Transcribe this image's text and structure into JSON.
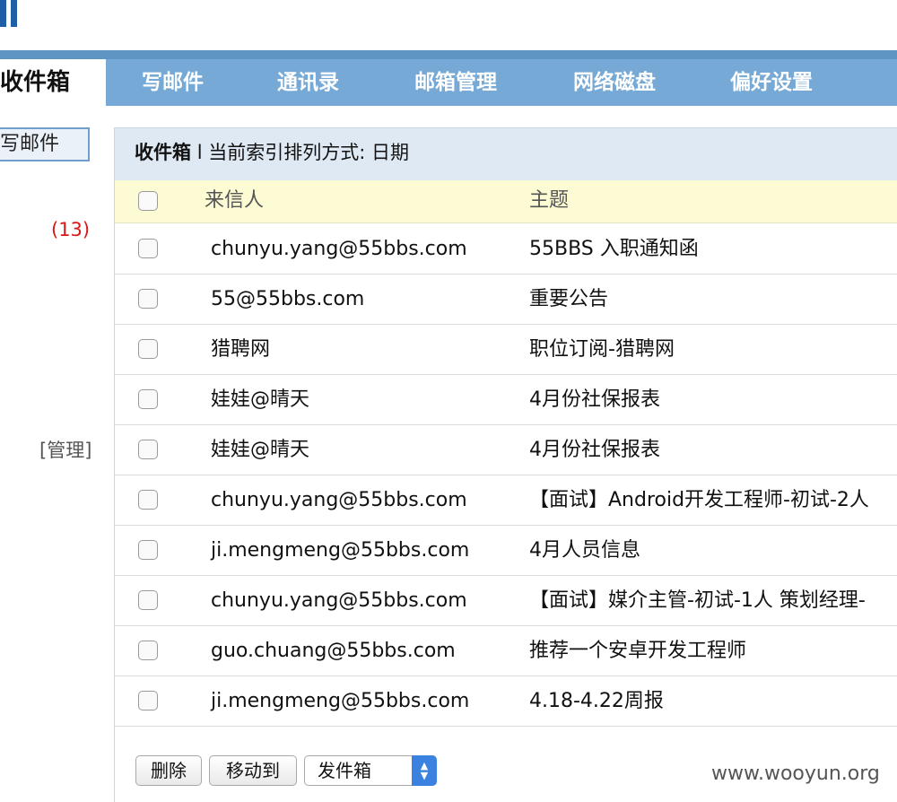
{
  "nav": {
    "active_tab": "收件箱",
    "items": [
      "写邮件",
      "通讯录",
      "邮箱管理",
      "网络磁盘",
      "偏好设置"
    ]
  },
  "sidebar": {
    "compose_label": "写邮件",
    "unread_count": "(13)",
    "manage_label": "[管理]"
  },
  "panel": {
    "title": "收件箱",
    "separator": "l",
    "sort_text": "当前索引排列方式: 日期"
  },
  "table": {
    "headers": {
      "from": "来信人",
      "subject": "主题"
    },
    "rows": [
      {
        "from": "chunyu.yang@55bbs.com",
        "subject": "55BBS 入职通知函"
      },
      {
        "from": "55@55bbs.com",
        "subject": "重要公告"
      },
      {
        "from": "猎聘网",
        "subject": "职位订阅-猎聘网"
      },
      {
        "from": "娃娃@晴天",
        "subject": "4月份社保报表"
      },
      {
        "from": "娃娃@晴天",
        "subject": "4月份社保报表"
      },
      {
        "from": "chunyu.yang@55bbs.com",
        "subject": "【面试】Android开发工程师-初试-2人"
      },
      {
        "from": "ji.mengmeng@55bbs.com",
        "subject": "4月人员信息"
      },
      {
        "from": "chunyu.yang@55bbs.com",
        "subject": "【面试】媒介主管-初试-1人 策划经理-"
      },
      {
        "from": "guo.chuang@55bbs.com",
        "subject": "推荐一个安卓开发工程师"
      },
      {
        "from": "ji.mengmeng@55bbs.com",
        "subject": "4.18-4.22周报"
      }
    ]
  },
  "actions": {
    "delete_label": "删除",
    "move_label": "移动到",
    "folder_selected": "发件箱"
  },
  "watermark": "www.wooyun.org",
  "colors": {
    "nav_bg": "#76a9d5",
    "topbar": "#5f95c3",
    "header_bg": "#dfe9f4",
    "colhead_bg": "#fdfbd3",
    "unread": "#d61a1a",
    "select_arrow": "#3b82e0"
  }
}
